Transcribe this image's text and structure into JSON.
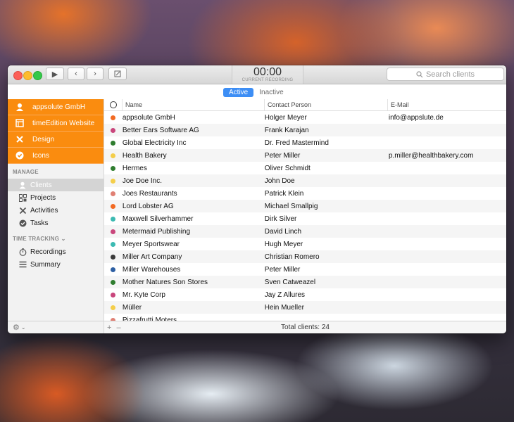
{
  "timer": {
    "time": "00:00",
    "sub": "CURRENT RECORDING"
  },
  "search": {
    "placeholder": "Search clients"
  },
  "filter": {
    "active": "Active",
    "inactive": "Inactive"
  },
  "sidebar": {
    "projects": [
      {
        "label": "appsolute GmbH",
        "icon": "person-icon"
      },
      {
        "label": "timeEdition Website",
        "icon": "web-icon"
      },
      {
        "label": "Design",
        "icon": "tools-icon"
      },
      {
        "label": "Icons",
        "icon": "check-icon"
      }
    ],
    "manage_title": "MANAGE",
    "manage": [
      {
        "label": "Clients",
        "icon": "person-icon",
        "selected": true
      },
      {
        "label": "Projects",
        "icon": "projects-icon"
      },
      {
        "label": "Activities",
        "icon": "tools-icon"
      },
      {
        "label": "Tasks",
        "icon": "check-icon"
      }
    ],
    "tracking_title": "TIME TRACKING",
    "tracking": [
      {
        "label": "Recordings",
        "icon": "stopwatch-icon"
      },
      {
        "label": "Summary",
        "icon": "list-icon"
      }
    ]
  },
  "table": {
    "headers": {
      "name": "Name",
      "contact": "Contact Person",
      "email": "E-Mail"
    },
    "rows": [
      {
        "color": "#f26a22",
        "name": "appsolute GmbH",
        "contact": "Holger Meyer",
        "email": "info@appslute.de"
      },
      {
        "color": "#c9467c",
        "name": "Better Ears Software AG",
        "contact": "Frank Karajan",
        "email": ""
      },
      {
        "color": "#2f7d2f",
        "name": "Global Electricity Inc",
        "contact": "Dr. Fred Mastermind",
        "email": ""
      },
      {
        "color": "#f4ce4a",
        "name": "Health Bakery",
        "contact": "Peter Miller",
        "email": "p.miller@healthbakery.com"
      },
      {
        "color": "#2f7d2f",
        "name": "Hermes",
        "contact": "Oliver Schmidt",
        "email": ""
      },
      {
        "color": "#f4ce4a",
        "name": "Joe Doe Inc.",
        "contact": "John Doe",
        "email": ""
      },
      {
        "color": "#e08074",
        "name": "Joes Restaurants",
        "contact": "Patrick Klein",
        "email": ""
      },
      {
        "color": "#f26a22",
        "name": "Lord Lobster AG",
        "contact": "Michael Smallpig",
        "email": ""
      },
      {
        "color": "#3cbab2",
        "name": "Maxwell Silverhammer",
        "contact": "Dirk Silver",
        "email": ""
      },
      {
        "color": "#c9467c",
        "name": "Metermaid Publishing",
        "contact": "David Linch",
        "email": ""
      },
      {
        "color": "#3cbab2",
        "name": "Meyer Sportswear",
        "contact": "Hugh Meyer",
        "email": ""
      },
      {
        "color": "#3a3a3a",
        "name": "Miller Art Company",
        "contact": "Christian Romero",
        "email": ""
      },
      {
        "color": "#2d5fa3",
        "name": "Miller Warehouses",
        "contact": "Peter Miller",
        "email": ""
      },
      {
        "color": "#2f7d2f",
        "name": "Mother Natures Son Stores",
        "contact": "Sven Catweazel",
        "email": ""
      },
      {
        "color": "#c9467c",
        "name": "Mr. Kyte Corp",
        "contact": "Jay Z Allures",
        "email": ""
      },
      {
        "color": "#f4ce4a",
        "name": "Müller",
        "contact": "Hein Mueller",
        "email": ""
      },
      {
        "color": "#e08074",
        "name": "Pizzafrutti Moters",
        "contact": "",
        "email": ""
      }
    ]
  },
  "footer": {
    "total": "Total clients: 24",
    "add": "+",
    "remove": "–"
  }
}
